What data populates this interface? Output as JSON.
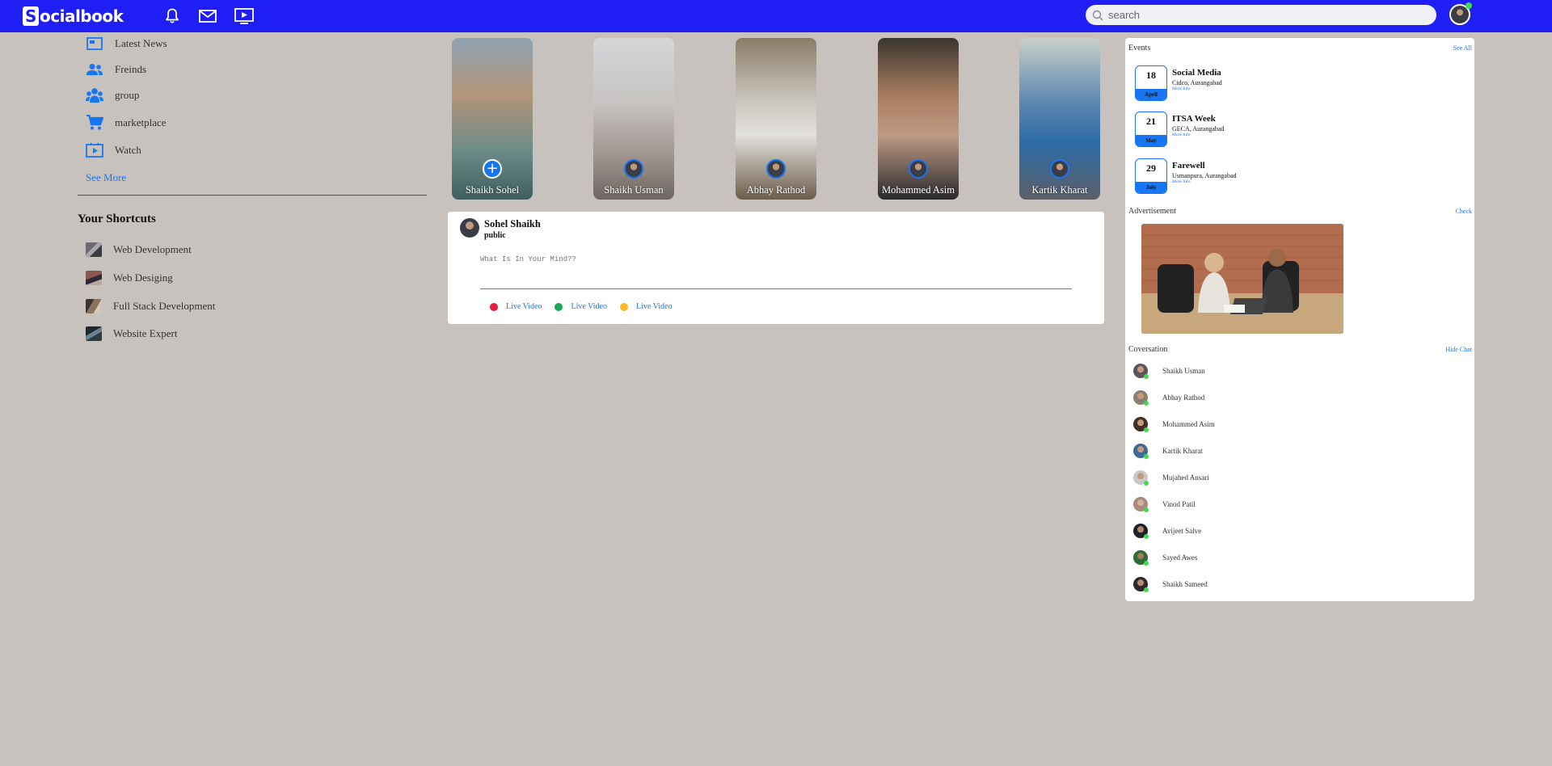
{
  "app": {
    "name": "socialbook",
    "logo_letter": "S",
    "logo_rest": "ocialbook"
  },
  "navbar": {
    "icons": [
      "bell-icon",
      "mail-icon",
      "video-icon"
    ],
    "search_placeholder": "search",
    "brand_color": "#1f1ff5"
  },
  "sidebar": {
    "items": [
      {
        "label": "Latest News",
        "icon": "news-icon"
      },
      {
        "label": "Freinds",
        "icon": "friends-icon"
      },
      {
        "label": "group",
        "icon": "group-icon"
      },
      {
        "label": "marketplace",
        "icon": "cart-icon"
      },
      {
        "label": "Watch",
        "icon": "watch-icon"
      }
    ],
    "see_more": "See More"
  },
  "shortcuts": {
    "title": "Your Shortcuts",
    "items": [
      {
        "label": "Web Development"
      },
      {
        "label": "Web Desiging"
      },
      {
        "label": "Full Stack Development"
      },
      {
        "label": "Website Expert"
      }
    ]
  },
  "stories": [
    {
      "name": "Shaikh Sohel",
      "add": true
    },
    {
      "name": "Shaikh Usman"
    },
    {
      "name": "Abhay Rathod"
    },
    {
      "name": "Mohammed Asim"
    },
    {
      "name": "Kartik Kharat"
    }
  ],
  "post": {
    "user": "Sohel Shaikh",
    "visibility": "public",
    "placeholder": "What Is In Your Mind??",
    "actions": [
      {
        "label": "Live Video",
        "color": "#e41e3f"
      },
      {
        "label": "Live Video",
        "color": "#18a957"
      },
      {
        "label": "Live Video",
        "color": "#f7b928"
      }
    ]
  },
  "events": {
    "title": "Events",
    "see_all": "See All",
    "items": [
      {
        "day": "18",
        "month": "April",
        "title": "Social Media",
        "location": "Cidco, Aurangabad",
        "more": "More Info"
      },
      {
        "day": "21",
        "month": "May",
        "title": "ITSA Week",
        "location": "GECA, Aurangabad",
        "more": "More Info"
      },
      {
        "day": "29",
        "month": "July",
        "title": "Farewell",
        "location": "Usmanpura, Aurangabad",
        "more": "More Info"
      }
    ]
  },
  "advertisement": {
    "title": "Advertisement",
    "link": "Check"
  },
  "conversation": {
    "title": "Coversation",
    "hide": "Hide Chat",
    "contacts": [
      {
        "name": "Shaikh Usman"
      },
      {
        "name": "Abhay Rathod"
      },
      {
        "name": "Mohammed Asim"
      },
      {
        "name": "Kartik Kharat"
      },
      {
        "name": "Mujahed Ansari"
      },
      {
        "name": "Vinod Patil"
      },
      {
        "name": "Avijeet Salve"
      },
      {
        "name": "Sayed Awes"
      },
      {
        "name": "Shaikh Sameed"
      }
    ]
  }
}
